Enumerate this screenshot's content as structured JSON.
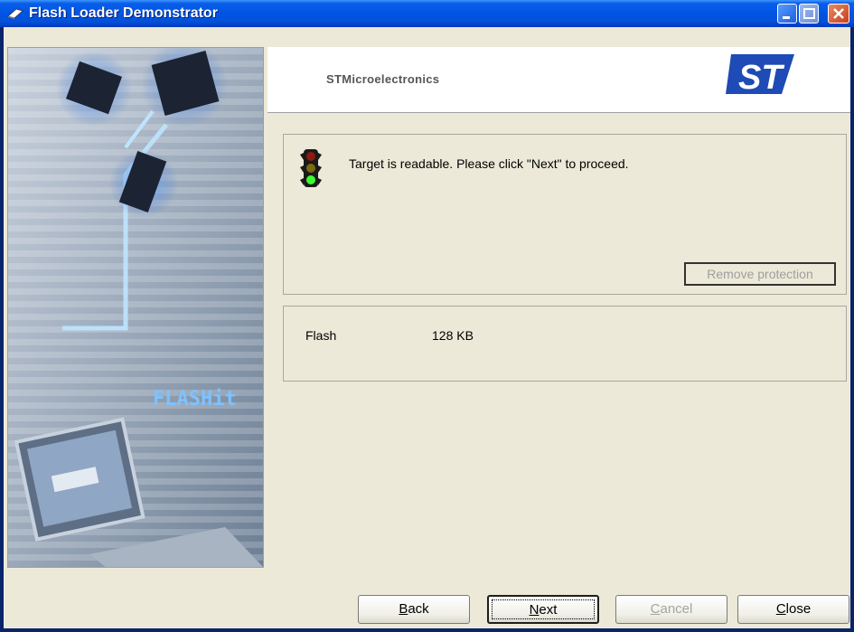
{
  "window": {
    "title": "Flash Loader Demonstrator"
  },
  "header": {
    "company": "STMicroelectronics",
    "logo_text": "ST"
  },
  "side_image": {
    "text": "FLASHit"
  },
  "message": {
    "text": "Target is readable. Please click \"Next\" to proceed.",
    "icon": "traffic-light-icon"
  },
  "remove_protection": {
    "label": "Remove protection",
    "enabled": false
  },
  "info": {
    "label": "Flash",
    "value": "128 KB"
  },
  "buttons": {
    "back": {
      "mnemonic": "B",
      "rest": "ack"
    },
    "next": {
      "mnemonic": "N",
      "rest": "ext"
    },
    "cancel": {
      "mnemonic": "C",
      "rest": "ancel",
      "enabled": false
    },
    "close": {
      "mnemonic": "C",
      "rest": "lose"
    }
  },
  "colors": {
    "titlebar": "#0055E5",
    "client": "#ECE9D8",
    "st_blue": "#1E4BB5"
  }
}
